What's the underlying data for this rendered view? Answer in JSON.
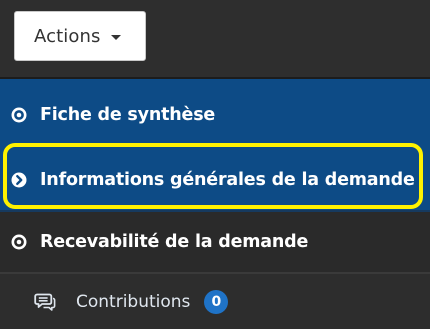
{
  "actions": {
    "label": "Actions"
  },
  "nav": {
    "items": [
      {
        "label": "Fiche de synthèse",
        "icon": "dot-circle-icon"
      },
      {
        "label": "Informations générales de la demande",
        "icon": "arrow-circle-right-icon"
      },
      {
        "label": "Recevabilité de la demande",
        "icon": "dot-circle-icon"
      }
    ]
  },
  "contributions": {
    "label": "Contributions",
    "count": "0",
    "icon": "comments-icon"
  },
  "colors": {
    "active_bg": "#0d4b86",
    "dark_bg": "#2d2d2d",
    "highlight": "#fff200",
    "badge": "#1f73c7"
  }
}
